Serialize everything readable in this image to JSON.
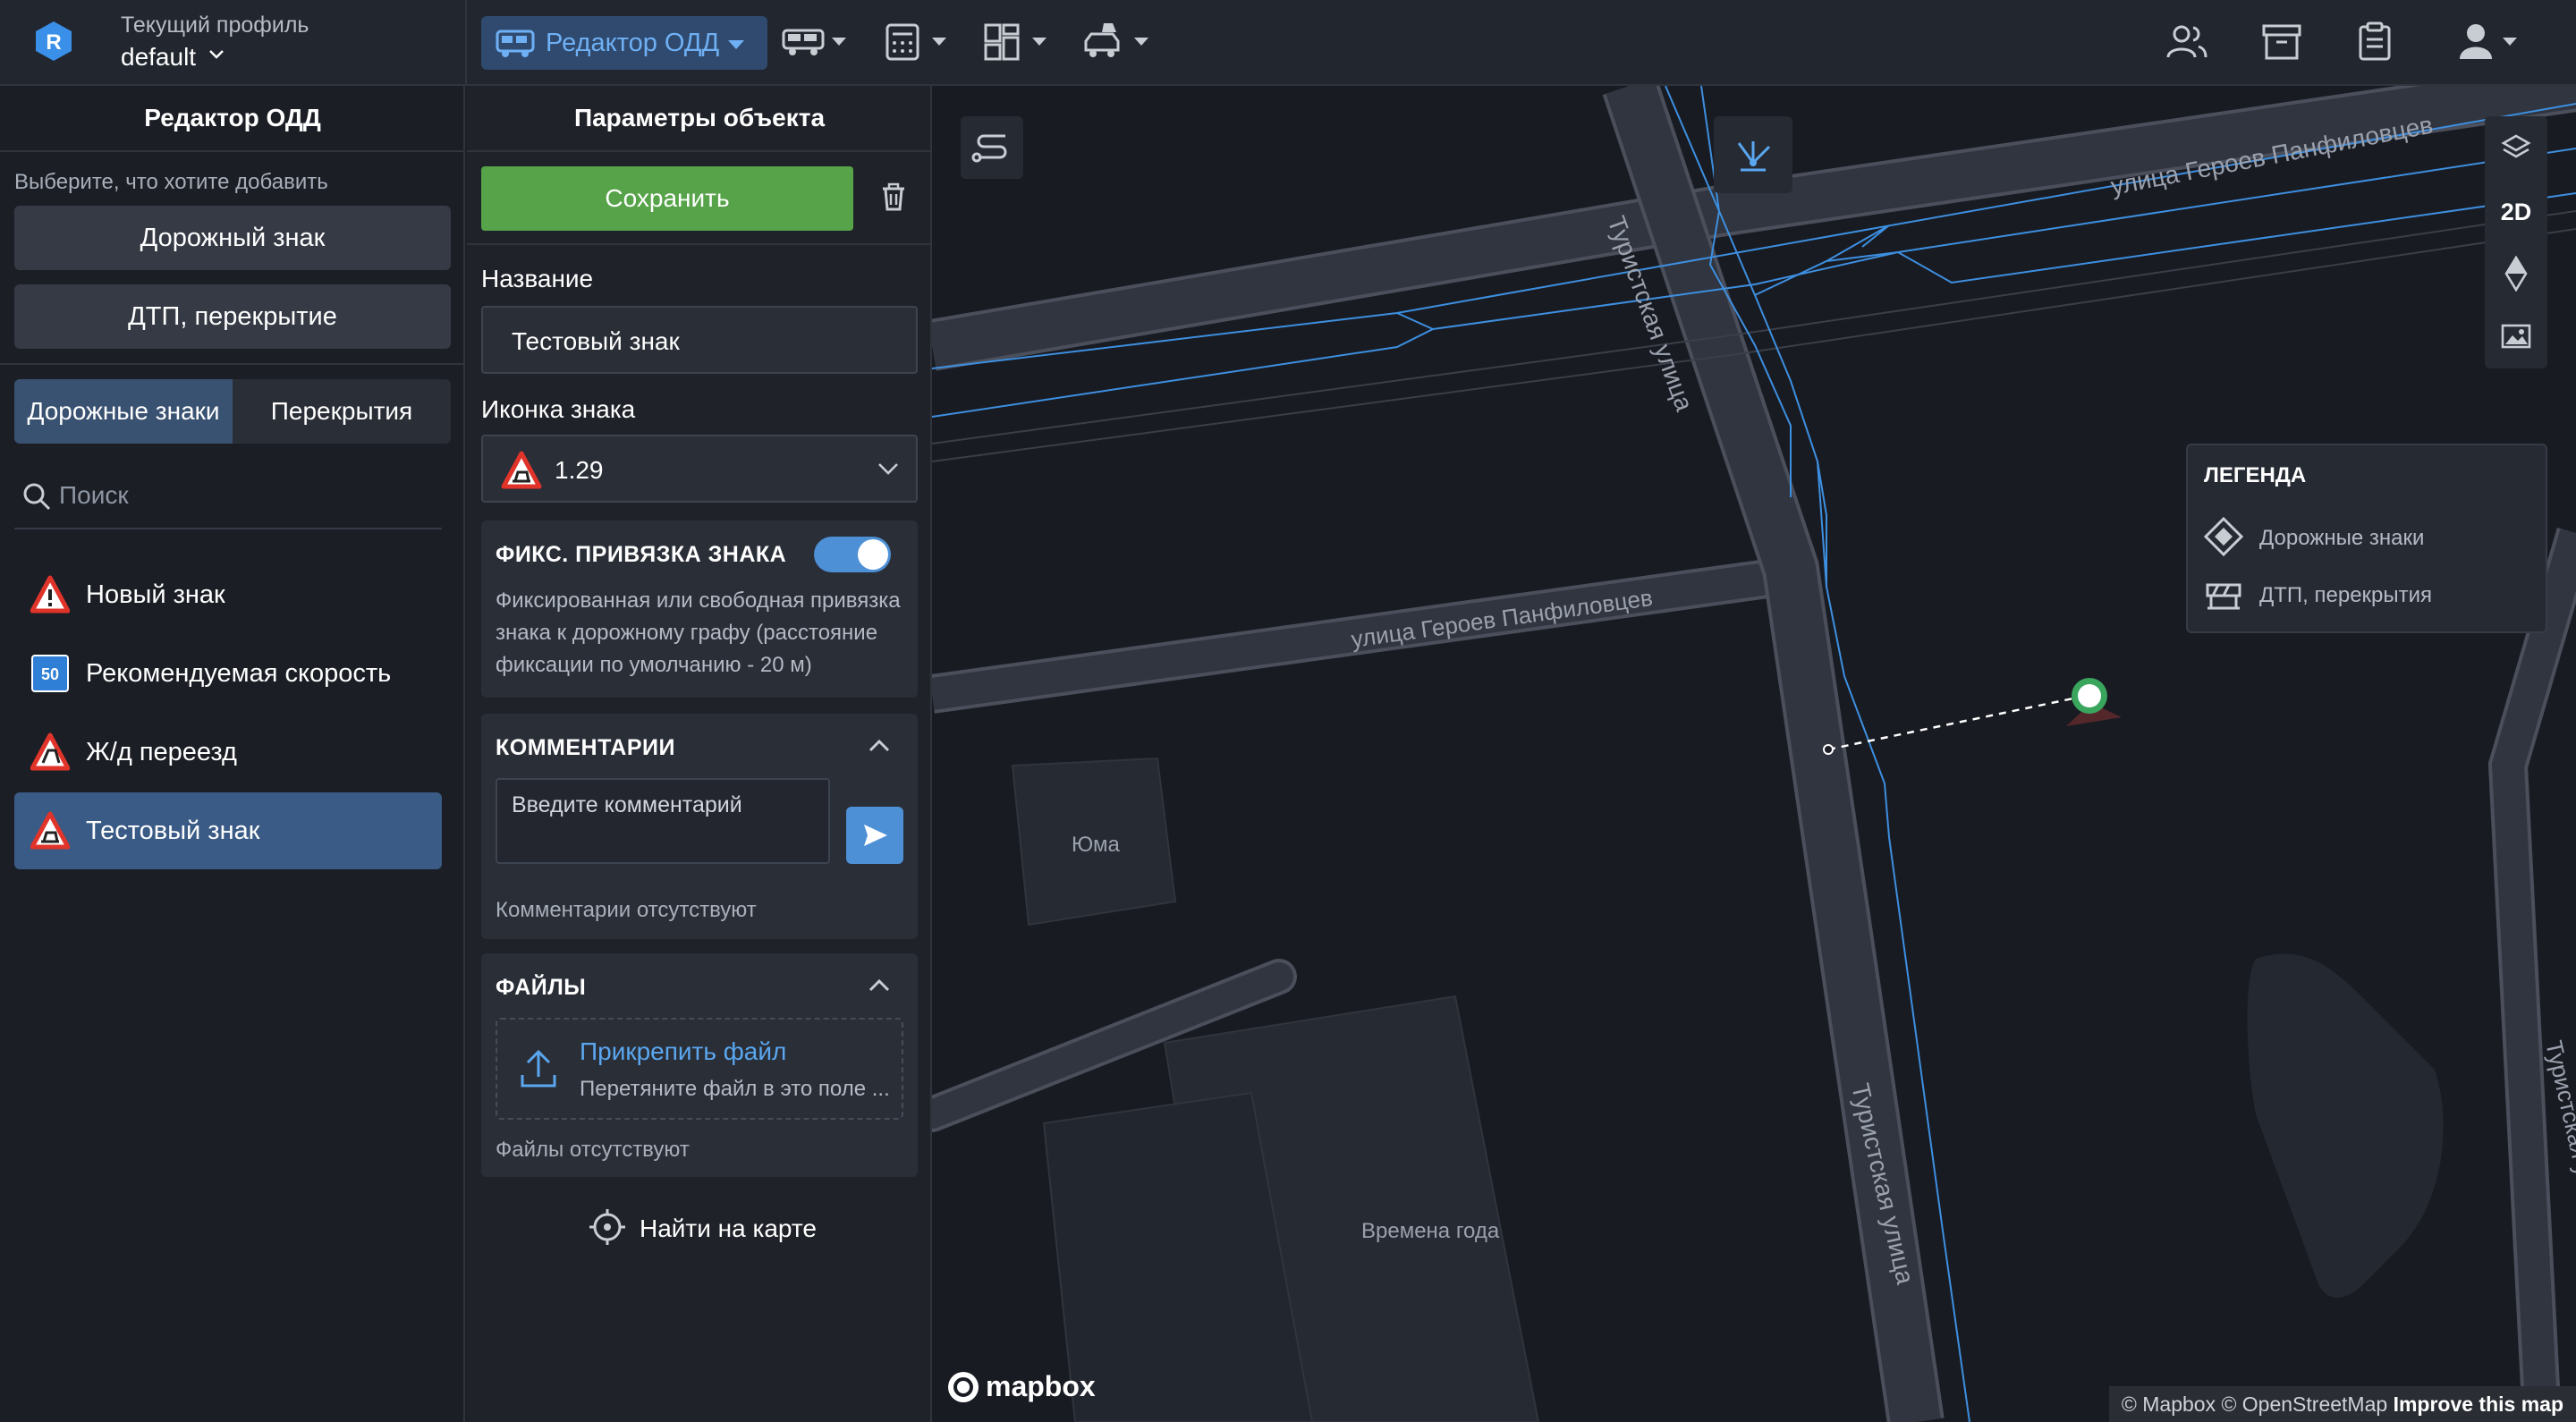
{
  "app": {
    "profile_label": "Текущий профиль",
    "profile_value": "default",
    "mode_label": "Редактор ОДД"
  },
  "left_panel": {
    "title": "Редактор ОДД",
    "hint": "Выберите, что хотите добавить",
    "add_buttons": [
      "Дорожный знак",
      "ДТП, перекрытие"
    ],
    "tabs": [
      {
        "label": "Дорожные знаки",
        "active": true
      },
      {
        "label": "Перекрытия",
        "active": false
      }
    ],
    "search_placeholder": "Поиск",
    "items": [
      {
        "label": "Новый знак",
        "icon": "warning-sign-icon",
        "selected": false
      },
      {
        "label": "Рекомендуемая скорость",
        "icon": "speed-50-sign-icon",
        "badge": "50",
        "selected": false
      },
      {
        "label": "Ж/д переезд",
        "icon": "railway-crossing-sign-icon",
        "selected": false
      },
      {
        "label": "Тестовый знак",
        "icon": "warning-sign-icon",
        "selected": true
      }
    ]
  },
  "params": {
    "title": "Параметры объекта",
    "close": "×",
    "save_label": "Сохранить",
    "name_label": "Название",
    "name_value": "Тестовый знак",
    "icon_label": "Иконка знака",
    "icon_value": "1.29",
    "binding": {
      "title": "ФИКС. ПРИВЯЗКА ЗНАКА",
      "enabled": true,
      "description": "Фиксированная или свободная привязка знака к дорожному графу (расстояние фиксации по умолчанию - 20 м)"
    },
    "comments": {
      "title": "КОММЕНТАРИИ",
      "placeholder": "Введите комментарий",
      "empty": "Комментарии отсутствуют"
    },
    "files": {
      "title": "ФАЙЛЫ",
      "attach": "Прикрепить файл",
      "drop_hint": "Перетяните файл в это поле ...",
      "empty": "Файлы отсутствуют"
    },
    "find_on_map": "Найти на карте"
  },
  "map": {
    "streets": [
      "улица Героев Панфиловцев",
      "Туристская улица",
      "улица Героев Панфиловцев",
      "Туристская улица",
      "Туристская у"
    ],
    "buildings": [
      "Юма",
      "Времена года"
    ],
    "controls": [
      "layers-icon",
      "2D",
      "compass-icon",
      "image-icon"
    ],
    "legend": {
      "title": "ЛЕГЕНДА",
      "items": [
        "Дорожные знаки",
        "ДТП, перекрытия"
      ]
    },
    "brand": "mapbox",
    "attribution": {
      "text": "© Mapbox © OpenStreetMap",
      "link": "Improve this map"
    }
  },
  "colors": {
    "accent": "#4d90d6",
    "save": "#56a349",
    "selected": "#3a5b85",
    "graph": "#3d8fe0"
  }
}
